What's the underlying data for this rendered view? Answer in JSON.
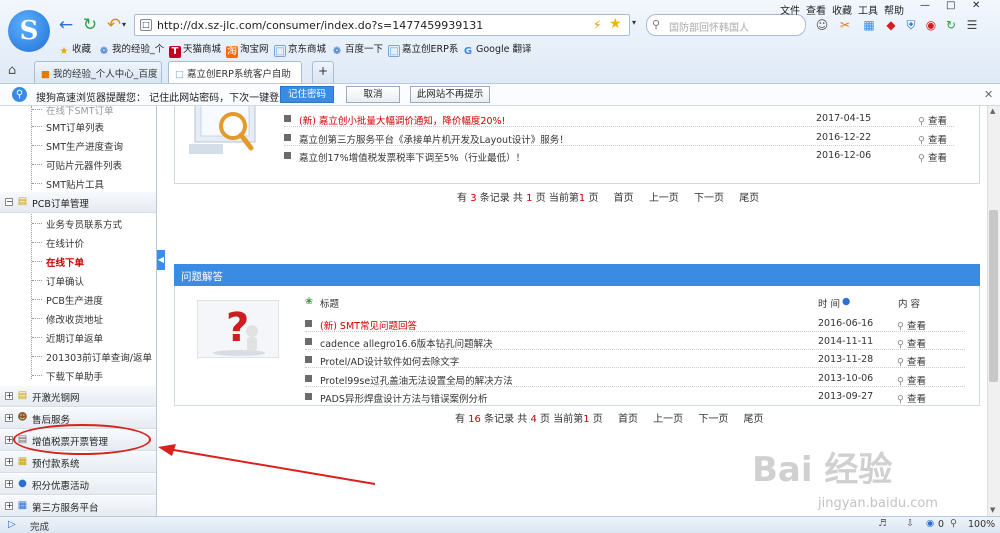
{
  "browser": {
    "menu": [
      "文件",
      "查看",
      "收藏",
      "工具",
      "帮助"
    ],
    "url": "http://dx.sz-jlc.com/consumer/index.do?s=1477459939131",
    "search_placeholder": "国防部回怀韩国人",
    "favorites": [
      {
        "label": "收藏",
        "icon": "star-icon",
        "color": "#e8a400"
      },
      {
        "label": "我的经验_个",
        "icon": "paw-icon",
        "color": "#2a6fd1"
      },
      {
        "label": "天猫商城",
        "icon": "tmall-icon",
        "color": "#c4001d"
      },
      {
        "label": "淘宝网",
        "icon": "taobao-icon",
        "color": "#ff6a00"
      },
      {
        "label": "京东商城",
        "icon": "jd-icon",
        "color": "#7aa7d9"
      },
      {
        "label": "百度一下",
        "icon": "baidu-icon",
        "color": "#2a6fd1"
      },
      {
        "label": "嘉立创ERP系",
        "icon": "page-icon",
        "color": "#7aa7d9"
      },
      {
        "label": "Google 翻译",
        "icon": "google-icon",
        "color": "#4285f4"
      }
    ],
    "tabs": [
      {
        "label": "我的经验_个人中心_百度",
        "active": false
      },
      {
        "label": "嘉立创ERP系统客户自助",
        "active": true
      }
    ],
    "new_tab": "+",
    "status": "完成",
    "status_right": [
      "0",
      "0",
      "100%"
    ]
  },
  "notify": {
    "message": "搜狗高速浏览器提醒您：  记住此网站密码，下次一键登录！",
    "buttons": [
      "记住密码",
      "取消",
      "此网站不再提示"
    ]
  },
  "sidebar": {
    "top_items": [
      "SMT订单列表",
      "SMT生产进度查询",
      "可贴片元器件列表",
      "SMT贴片工具"
    ],
    "pcb_group": "PCB订单管理",
    "pcb_items": [
      {
        "label": "业务专员联系方式",
        "highlight": false
      },
      {
        "label": "在线计价",
        "highlight": false
      },
      {
        "label": "在线下单",
        "highlight": true
      },
      {
        "label": "订单确认",
        "highlight": false
      },
      {
        "label": "PCB生产进度",
        "highlight": false
      },
      {
        "label": "修改收货地址",
        "highlight": false
      },
      {
        "label": "近期订单返单",
        "highlight": false
      },
      {
        "label": "201303前订单查询/返单",
        "highlight": false
      },
      {
        "label": "下载下单助手",
        "highlight": false
      }
    ],
    "groups": [
      {
        "label": "开激光钢网",
        "icon": "folder-icon"
      },
      {
        "label": "售后服务",
        "icon": "user-icon"
      },
      {
        "label": "增值税票开票管理",
        "icon": "document-icon"
      },
      {
        "label": "预付款系统",
        "icon": "wallet-icon"
      },
      {
        "label": "积分优惠活动",
        "icon": "globe-icon"
      },
      {
        "label": "第三方服务平台",
        "icon": "grid-icon"
      }
    ]
  },
  "notices": {
    "rows": [
      {
        "title": "(新) 嘉立创小批量大幅调价通知，降价幅度20%!",
        "date": "2017-04-15",
        "view": "查看",
        "red": true
      },
      {
        "title": "嘉立创第三方服务平台《承接单片机开发及Layout设计》服务！",
        "date": "2016-12-22",
        "view": "查看",
        "red": false
      },
      {
        "title": "嘉立创17%增值税发票税率下调至5%（行业最低）！",
        "date": "2016-12-06",
        "view": "查看",
        "red": false
      }
    ],
    "pager": {
      "pre": "有",
      "count": "3",
      "mid1": "条记录 共",
      "pages": "1",
      "mid2": "页 当前第",
      "current": "1",
      "post": "页",
      "links": [
        "首页",
        "上一页",
        "下一页",
        "尾页"
      ]
    }
  },
  "qa": {
    "title": "问题解答",
    "col_title": "标题",
    "col_time": "时 间",
    "col_content": "内 容",
    "rows": [
      {
        "title": "(新) SMT常见问题回答",
        "date": "2016-06-16",
        "view": "查看",
        "red": true
      },
      {
        "title": "cadence allegro16.6版本钻孔问题解决",
        "date": "2014-11-11",
        "view": "查看",
        "red": false
      },
      {
        "title": "Protel/AD设计软件如何去除文字",
        "date": "2013-11-28",
        "view": "查看",
        "red": false
      },
      {
        "title": "Protel99se过孔盖油无法设置全局的解决方法",
        "date": "2013-10-06",
        "view": "查看",
        "red": false
      },
      {
        "title": "PADS异形焊盘设计方法与错误案例分析",
        "date": "2013-09-27",
        "view": "查看",
        "red": false
      }
    ],
    "pager": {
      "pre": "有",
      "count": "16",
      "mid1": "条记录 共",
      "pages": "4",
      "mid2": "页 当前第",
      "current": "1",
      "post": "页",
      "links": [
        "首页",
        "上一页",
        "下一页",
        "尾页"
      ]
    }
  },
  "watermark": {
    "brand": "Bai 经验",
    "domain": "jingyan.baidu.com"
  },
  "colors": {
    "accent": "#3a8be3",
    "red": "#cc0000",
    "annotation": "#d9211d"
  }
}
